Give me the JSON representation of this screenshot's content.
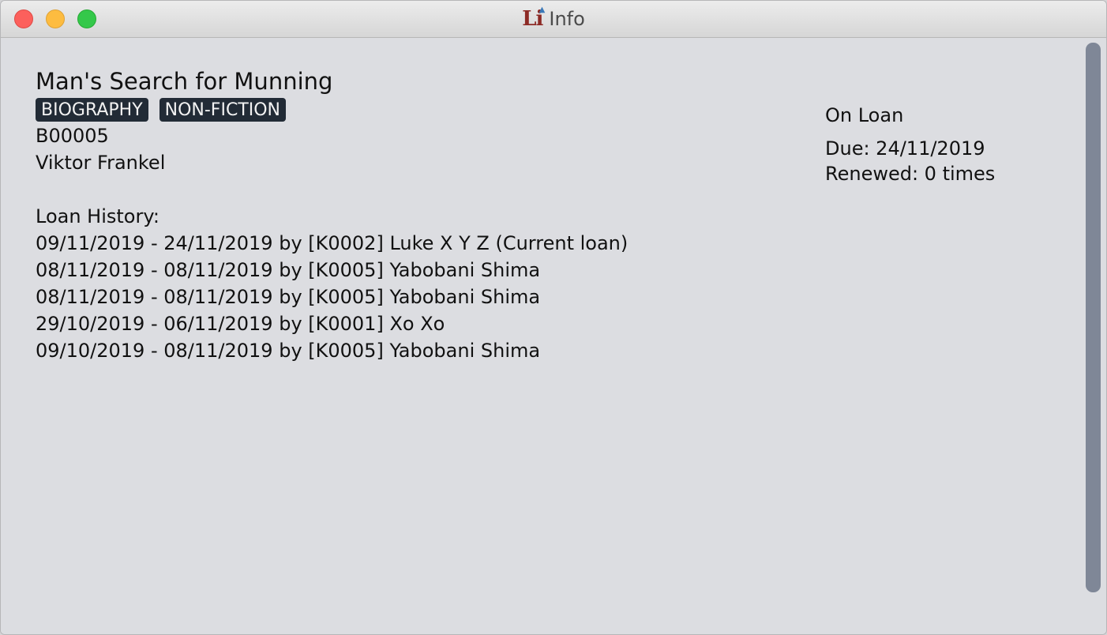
{
  "window": {
    "title": "Info",
    "app_logo": "Li"
  },
  "book": {
    "title": "Man's Search for Munning",
    "tags": [
      "BIOGRAPHY",
      "NON-FICTION"
    ],
    "id": "B00005",
    "author": "Viktor Frankel"
  },
  "status": {
    "state": "On Loan",
    "due": "Due: 24/11/2019",
    "renewed": "Renewed: 0 times"
  },
  "loan_history": {
    "heading": "Loan History:",
    "entries": [
      "09/11/2019 - 24/11/2019 by [K0002] Luke X Y Z (Current loan)",
      "08/11/2019 - 08/11/2019 by [K0005] Yabobani Shima",
      "08/11/2019 - 08/11/2019 by [K0005] Yabobani Shima",
      "29/10/2019 - 06/11/2019 by [K0001] Xo Xo",
      "09/10/2019 - 08/11/2019 by [K0005] Yabobani Shima"
    ]
  },
  "colors": {
    "close": "#fc605c",
    "minimize": "#fdbc40",
    "zoom": "#34c84a",
    "tag_bg": "#222b36",
    "logo": "#8d2a25"
  }
}
